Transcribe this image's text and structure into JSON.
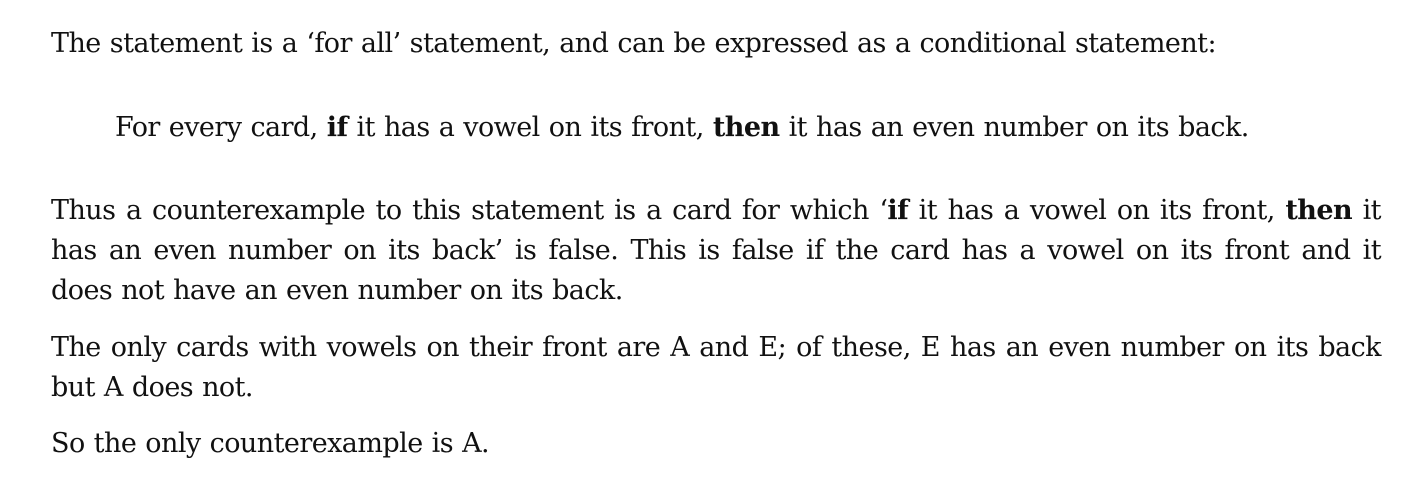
{
  "document": {
    "p1": {
      "text": "The statement is a ‘for all’ statement, and can be expressed as a conditional statement:"
    },
    "p2": {
      "a": "For every card, ",
      "b1": "if",
      "c": " it has a vowel on its front, ",
      "b2": "then",
      "d": " it has an even number on its back."
    },
    "p3": {
      "a": "Thus a counterexample to this statement is a card for which ‘",
      "b1": "if",
      "c": " it has a vowel on its front, ",
      "b2": "then",
      "d": " it has an even number on its back’ is false. This is false if the card has a vowel on its front and it does not have an even number on its back."
    },
    "p4": {
      "text": "The only cards with vowels on their front are A and E; of these, E has an even number on its back but A does not."
    },
    "p5": {
      "text": "So the only counterexample is A."
    }
  }
}
